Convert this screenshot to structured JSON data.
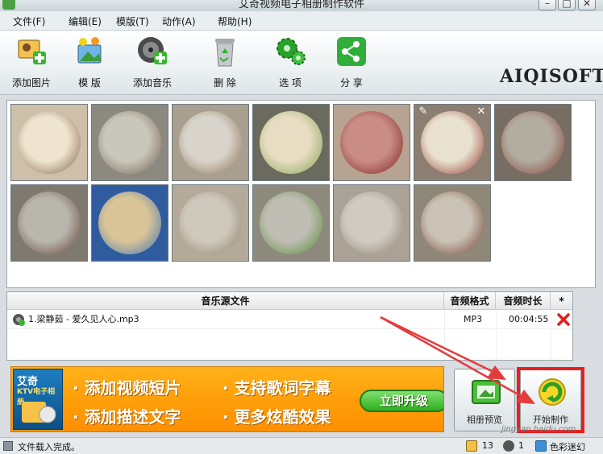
{
  "window": {
    "title": "艾奇视频电子相册制作软件",
    "min": "–",
    "max": "□",
    "close": "✕"
  },
  "menu": [
    "文件(F)",
    "编辑(E)",
    "模版(T)",
    "动作(A)",
    "帮助(H)"
  ],
  "toolbar": {
    "add_photo": "添加图片",
    "template": "模 版",
    "add_music": "添加音乐",
    "delete": "删 除",
    "options": "选 项",
    "share": "分 享"
  },
  "logo": "AIQISOFT",
  "photos": [
    {
      "bg": "#cdbfa8",
      "plate": "#efe4cf",
      "accent": "#7b5a45"
    },
    {
      "bg": "#8c8a80",
      "plate": "#c9c7bb",
      "accent": "#6f5b4b"
    },
    {
      "bg": "#a89f8f",
      "plate": "#d8d4cb",
      "accent": "#8a6a4c"
    },
    {
      "bg": "#6a6a5e",
      "plate": "#e8dcc2",
      "accent": "#7aa04a"
    },
    {
      "bg": "#b7a391",
      "plate": "#c98d86",
      "accent": "#7a1f1a"
    },
    {
      "bg": "#8c7f72",
      "plate": "#e8e1d0",
      "accent": "#8f2c22"
    },
    {
      "bg": "#786d62",
      "plate": "#b3aca0",
      "accent": "#7f3b2f"
    },
    {
      "bg": "#7f7a70",
      "plate": "#b9b6ad",
      "accent": "#5f3a30"
    },
    {
      "bg": "#2f5c9f",
      "plate": "#d8c496",
      "accent": "#3b6fb4"
    },
    {
      "bg": "#b4aa9a",
      "plate": "#cfc9bd",
      "accent": "#8e7b63"
    },
    {
      "bg": "#8e897d",
      "plate": "#bfbdb3",
      "accent": "#4e8a2f"
    },
    {
      "bg": "#aaa197",
      "plate": "#cfcbc3",
      "accent": "#8c7a63"
    },
    {
      "bg": "#8f8777",
      "plate": "#c9c2b5",
      "accent": "#6f3b2a"
    }
  ],
  "music": {
    "headers": [
      "音乐源文件",
      "音频格式",
      "音频时长",
      "*"
    ],
    "rows": [
      {
        "file": "1.梁静茹 - 爱久见人心.mp3",
        "format": "MP3",
        "duration": "00:04:55"
      }
    ]
  },
  "banner": {
    "box_line1": "艾奇",
    "box_line2": "KTV电子相册",
    "features": [
      "· 添加视频短片",
      "· 支持歌词字幕",
      "· 添加描述文字",
      "· 更多炫酷效果"
    ],
    "upgrade": "立即升级"
  },
  "actions": {
    "preview": "相册预览",
    "start": "开始制作"
  },
  "status": {
    "message": "文件载入完成。",
    "photo_count": "13",
    "music_count": "1",
    "theme": "色彩迷幻"
  },
  "watermark": "jingyan.baidu.com",
  "colors": {
    "accent_green": "#2fae1c",
    "highlight_red": "#e81f1f",
    "arrow_red": "#e53b3b",
    "banner_orange": "#ff9f0a"
  }
}
